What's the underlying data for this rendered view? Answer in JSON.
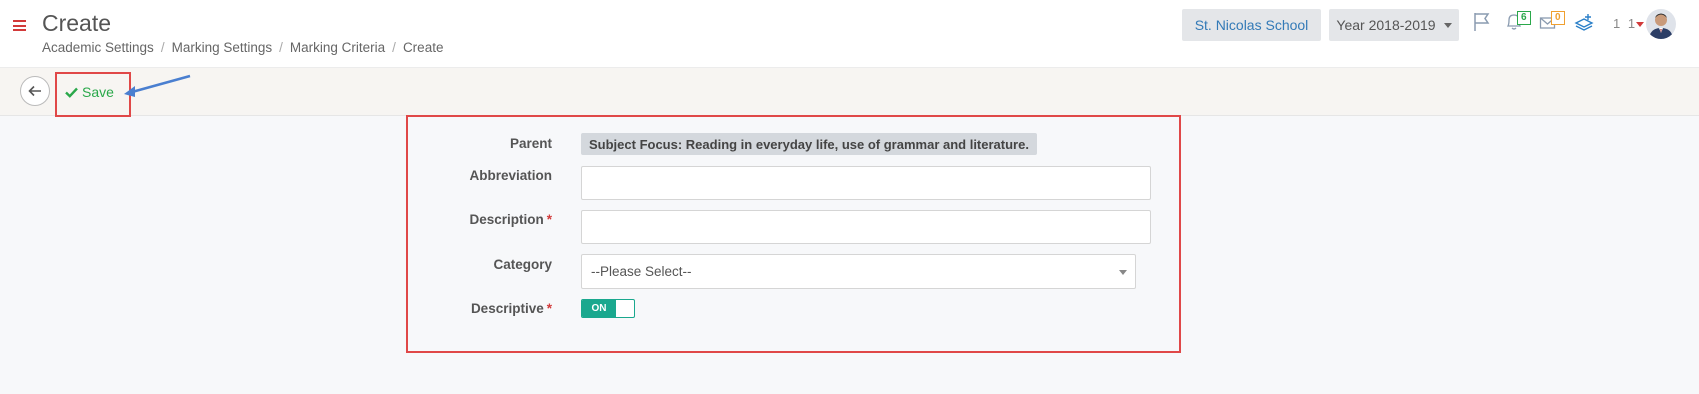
{
  "header": {
    "title": "Create",
    "breadcrumb": [
      "Academic Settings",
      "Marking Settings",
      "Marking Criteria",
      "Create"
    ],
    "school": "St. Nicolas School",
    "year": "Year 2018-2019",
    "notifications_count": "6",
    "messages_count": "0",
    "user_number": "1 1"
  },
  "toolbar": {
    "save_label": "Save"
  },
  "form": {
    "parent_label": "Parent",
    "parent_value": "Subject Focus: Reading in everyday life, use of grammar and literature.",
    "abbreviation_label": "Abbreviation",
    "abbreviation_value": "",
    "description_label": "Description",
    "description_value": "",
    "required_mark": "*",
    "category_label": "Category",
    "category_value": "--Please Select--",
    "descriptive_label": "Descriptive",
    "descriptive_toggle": "ON"
  },
  "colors": {
    "accent_green": "#2aa84a",
    "toggle_teal": "#1aa88e",
    "highlight_red": "#e04848",
    "menu_red": "#d23a3a"
  }
}
